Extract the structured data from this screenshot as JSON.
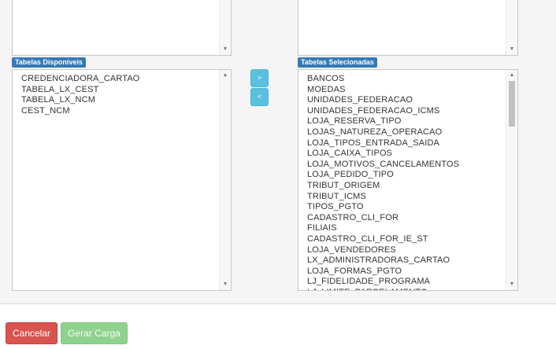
{
  "available": {
    "label": "Tabelas Disponíveis",
    "items": [
      "CREDENCIADORA_CARTAO",
      "TABELA_LX_CEST",
      "TABELA_LX_NCM",
      "CEST_NCM"
    ]
  },
  "selected": {
    "label": "Tabelas Selecionadas",
    "items": [
      "BANCOS",
      "MOEDAS",
      "UNIDADES_FEDERACAO",
      "UNIDADES_FEDERACAO_ICMS",
      "LOJA_RESERVA_TIPO",
      "LOJAS_NATUREZA_OPERACAO",
      "LOJA_TIPOS_ENTRADA_SAIDA",
      "LOJA_CAIXA_TIPOS",
      "LOJA_MOTIVOS_CANCELAMENTOS",
      "LOJA_PEDIDO_TIPO",
      "TRIBUT_ORIGEM",
      "TRIBUT_ICMS",
      "TIPOS_PGTO",
      "CADASTRO_CLI_FOR",
      "FILIAIS",
      "CADASTRO_CLI_FOR_IE_ST",
      "LOJA_VENDEDORES",
      "LX_ADMINISTRADORAS_CARTAO",
      "LOJA_FORMAS_PGTO",
      "LJ_FIDELIDADE_PROGRAMA",
      "LJ_LIMITE_PARCELAMENTO"
    ]
  },
  "controls": {
    "move_right": ">",
    "move_left": "<"
  },
  "footer": {
    "cancel": "Cancelar",
    "generate": "Gerar Carga"
  },
  "colors": {
    "cancel": "#d9534f",
    "generate": "#8fd18f",
    "label": "#337ab7",
    "move": "#5bc0de"
  }
}
